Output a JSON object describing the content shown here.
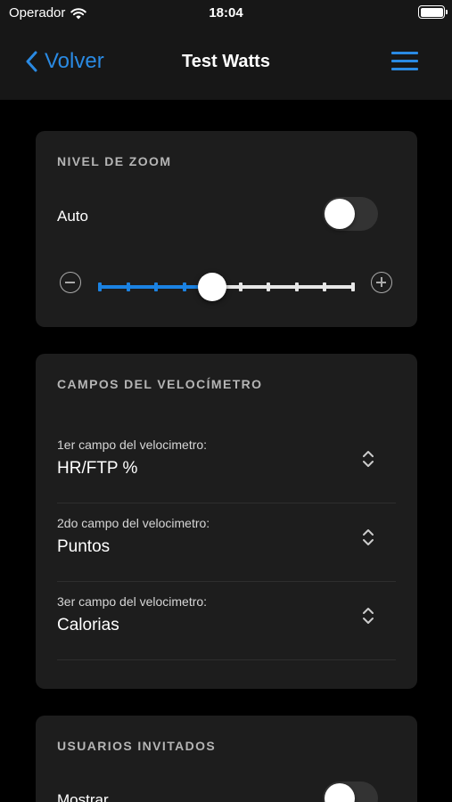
{
  "status_bar": {
    "carrier": "Operador",
    "time": "18:04"
  },
  "nav": {
    "back_label": "Volver",
    "title": "Test Watts"
  },
  "zoom_card": {
    "title": "NIVEL DE ZOOM",
    "auto_label": "Auto",
    "auto_on": false,
    "slider": {
      "steps": 10,
      "value_step": 4
    }
  },
  "speedometer_card": {
    "title": "CAMPOS DEL VELOCÍMETRO",
    "fields": [
      {
        "label": "1er campo del velocimetro:",
        "value": "HR/FTP %"
      },
      {
        "label": "2do campo del velocimetro:",
        "value": "Puntos"
      },
      {
        "label": "3er campo del velocimetro:",
        "value": "Calorias"
      }
    ]
  },
  "guests_card": {
    "title": "USUARIOS INVITADOS",
    "show_label": "Mostrar",
    "show_on": false
  },
  "colors": {
    "accent": "#2a8ae3",
    "slider_fill": "#1b82e2",
    "card_bg": "#1d1d1d",
    "bar_bg": "#171717"
  }
}
